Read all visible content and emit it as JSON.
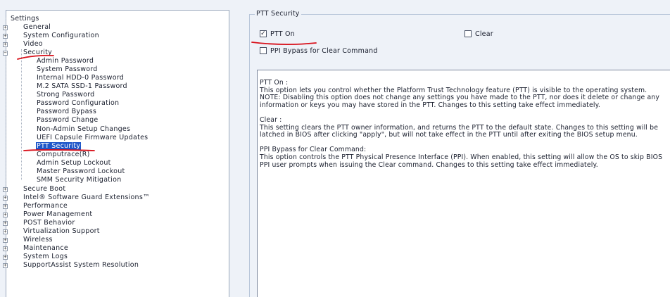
{
  "tree": {
    "root_label": "Settings",
    "expand_glyph": "+",
    "collapse_glyph": "−",
    "items_top": [
      {
        "label": "General",
        "expand": "+"
      },
      {
        "label": "System Configuration",
        "expand": "+"
      },
      {
        "label": "Video",
        "expand": "+"
      },
      {
        "label": "Security",
        "expand": "−"
      }
    ],
    "security_children": [
      "Admin Password",
      "System Password",
      "Internal HDD-0 Password",
      "M.2 SATA SSD-1 Password",
      "Strong Password",
      "Password Configuration",
      "Password Bypass",
      "Password Change",
      "Non-Admin Setup Changes",
      "UEFI Capsule Firmware Updates",
      "PTT Security",
      "Computrace(R)",
      "Admin Setup Lockout",
      "Master Password Lockout",
      "SMM Security Mitigation"
    ],
    "selected": "PTT Security",
    "items_bottom": [
      "Secure Boot",
      "Intel® Software Guard Extensions™",
      "Performance",
      "Power Management",
      "POST Behavior",
      "Virtualization Support",
      "Wireless",
      "Maintenance",
      "System Logs",
      "SupportAssist System Resolution"
    ]
  },
  "group": {
    "title": "PTT Security",
    "options": {
      "ptt_on": {
        "label": "PTT On",
        "checked": true
      },
      "clear": {
        "label": "Clear",
        "checked": false
      },
      "ppi_bypass": {
        "label": "PPI Bypass for Clear Command",
        "checked": false
      }
    }
  },
  "help": {
    "sections": [
      {
        "heading": "PTT On :",
        "body": "This option lets you control whether the Platform Trust Technology feature (PTT) is visible to the operating system.",
        "note": "NOTE: Disabling this option does not change any settings you have made to the PTT, nor does it delete or change any information or keys you may have stored in the PTT. Changes to this setting take effect immediately."
      },
      {
        "heading": "Clear :",
        "body": "This setting clears the PTT owner information, and returns the PTT to the default state. Changes to this setting will be latched in BIOS after clicking \"apply\", but will not take effect in the PTT until after exiting the BIOS setup menu."
      },
      {
        "heading": "PPI Bypass for Clear Command:",
        "body": "This option controls the PTT Physical Presence Interface (PPI). When enabled, this setting will allow the OS to skip BIOS PPI user prompts when issuing the Clear command. Changes to this setting take effect immediately."
      }
    ]
  },
  "colors": {
    "selection": "#1f57c9",
    "annotation_red": "#d8101a"
  }
}
